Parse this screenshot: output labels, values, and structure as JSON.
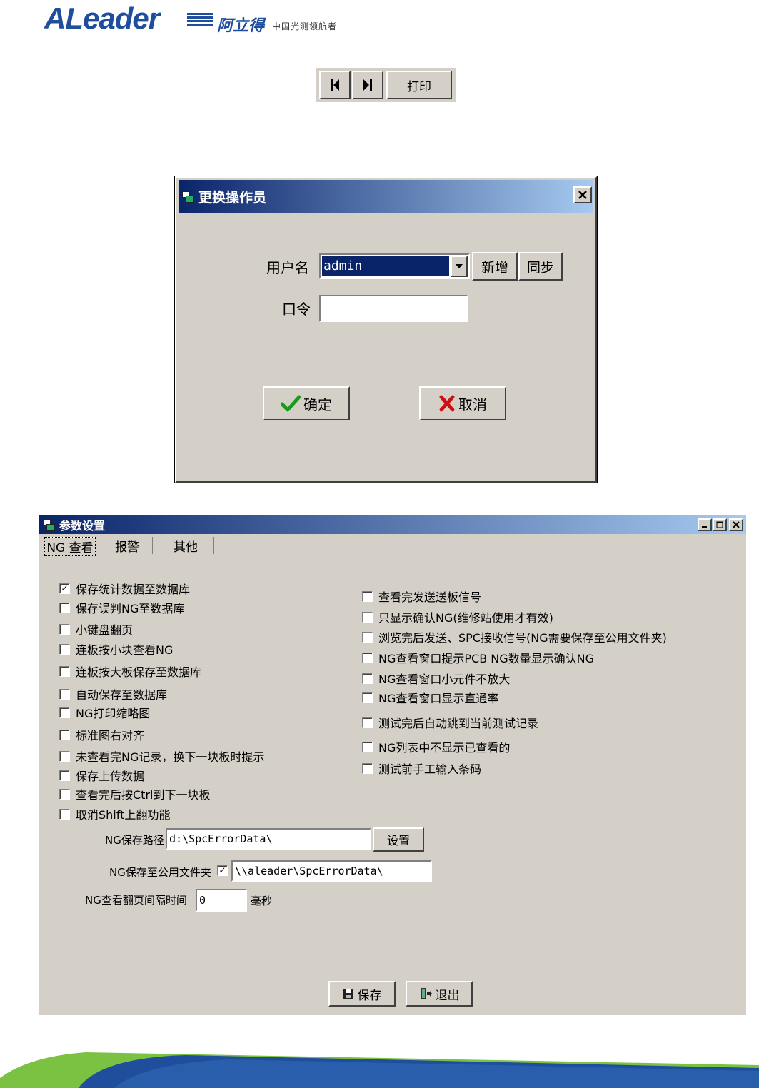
{
  "header": {
    "logo_text": "ALeader",
    "logo_cn": "阿立得",
    "slogan": "中国光测领航者"
  },
  "nav_toolbar": {
    "first_icon": "skip-back-icon",
    "next_icon": "skip-forward-icon",
    "print_label": "打印"
  },
  "operator_dialog": {
    "title": "更换操作员",
    "username_label": "用户名",
    "username_value": "admin",
    "add_label": "新增",
    "sync_label": "同步",
    "password_label": "口令",
    "password_value": "",
    "ok_label": "确定",
    "cancel_label": "取消"
  },
  "param_window": {
    "title": "参数设置",
    "tabs": [
      {
        "label": "NG 查看",
        "active": true
      },
      {
        "label": "报警",
        "active": false
      },
      {
        "label": "其他",
        "active": false
      }
    ],
    "left_options": [
      {
        "label": "保存统计数据至数据库",
        "checked": true
      },
      {
        "label": "保存误判NG至数据库",
        "checked": false
      },
      {
        "label": "小键盘翻页",
        "checked": false
      },
      {
        "label": "连板按小块查看NG",
        "checked": false
      },
      {
        "label": "连板按大板保存至数据库",
        "checked": false
      },
      {
        "label": "自动保存至数据库",
        "checked": false
      },
      {
        "label": "NG打印缩略图",
        "checked": false
      },
      {
        "label": "标准图右对齐",
        "checked": false
      },
      {
        "label": "未查看完NG记录，换下一块板时提示",
        "checked": false
      },
      {
        "label": "保存上传数据",
        "checked": false
      },
      {
        "label": "查看完后按Ctrl到下一块板",
        "checked": false
      },
      {
        "label": "取消Shift上翻功能",
        "checked": false
      }
    ],
    "right_options": [
      {
        "label": "查看完发送送板信号",
        "checked": false
      },
      {
        "label": "只显示确认NG(维修站使用才有效)",
        "checked": false
      },
      {
        "label": "浏览完后发送、SPC接收信号(NG需要保存至公用文件夹)",
        "checked": false
      },
      {
        "label": "NG查看窗口提示PCB NG数量显示确认NG",
        "checked": false
      },
      {
        "label": "NG查看窗口小元件不放大",
        "checked": false
      },
      {
        "label": "NG查看窗口显示直通率",
        "checked": false
      },
      {
        "label": "测试完后自动跳到当前测试记录",
        "checked": false
      },
      {
        "label": "NG列表中不显示已查看的",
        "checked": false
      },
      {
        "label": "测试前手工输入条码",
        "checked": false
      }
    ],
    "ng_path_label": "NG保存路径",
    "ng_path_value": "d:\\SpcErrorData\\",
    "set_button": "设置",
    "public_folder_label": "NG保存至公用文件夹",
    "public_folder_checked": true,
    "public_folder_value": "\\\\aleader\\SpcErrorData\\",
    "interval_label": "NG查看翻页间隔时间",
    "interval_value": "0",
    "interval_unit": "毫秒",
    "save_label": "保存",
    "exit_label": "退出"
  },
  "colors": {
    "dialog_bg": "#d4d0c8",
    "title_start": "#0a246a",
    "title_end": "#a6caf0",
    "selection": "#0a246a",
    "brand_blue": "#1f4f9c",
    "brand_green": "#7cc242"
  }
}
